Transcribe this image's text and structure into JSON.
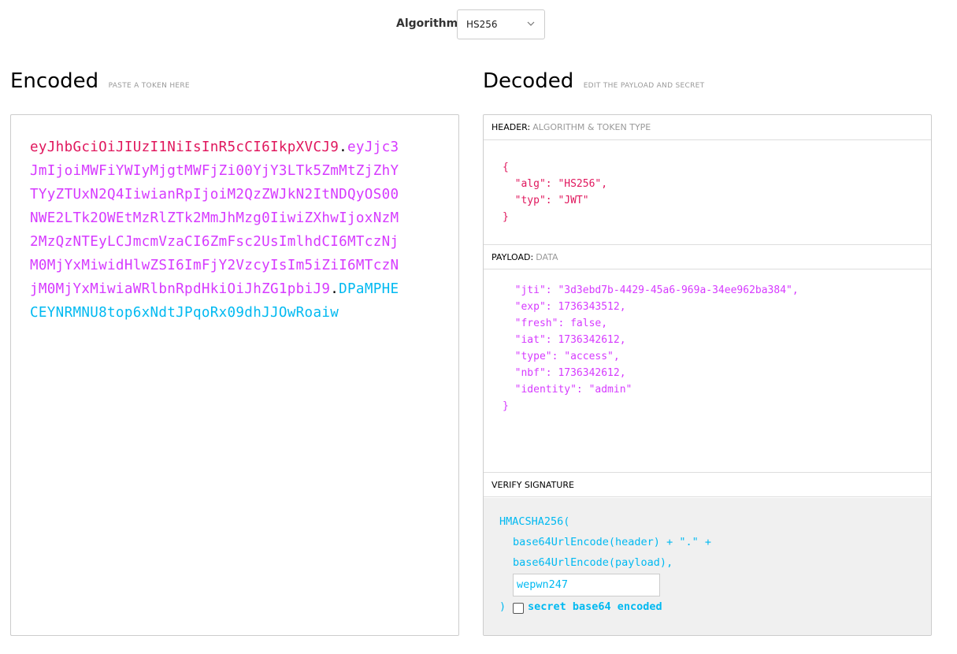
{
  "algorithm": {
    "label": "Algorithm",
    "selected": "HS256"
  },
  "encoded": {
    "title": "Encoded",
    "subtitle": "PASTE A TOKEN HERE",
    "token": {
      "header": "eyJhbGciOiJIUzI1NiIsInR5cCI6IkpXVCJ9",
      "payload": "eyJjc3JmIjoiMWFiYWIyMjgtMWFjZi00YjY3LTk5ZmMtZjZhYTYyZTUxN2Q4IiwianRpIjoiM2QzZWJkN2ItNDQyOS00NWE2LTk2OWEtMzRlZTk2MmJhMzg0IiwiZXhwIjoxNzM2MzQzNTEyLCJmcmVzaCI6ZmFsc2UsImlhdCI6MTczNjM0MjYxMiwidHlwZSI6ImFjY2VzcyIsIm5iZiI6MTczNjM0MjYxMiwiaWRlbnRpdHkiOiJhZG1pbiJ9",
      "signature": "DPaMPHECEYNRMNU8top6xNdtJPqoRx09dhJJOwRoaiw",
      "dot": "."
    }
  },
  "decoded": {
    "title": "Decoded",
    "subtitle": "EDIT THE PAYLOAD AND SECRET",
    "header_section": {
      "label": "HEADER:",
      "sub": "ALGORITHM & TOKEN TYPE"
    },
    "header_json": "{\n  \"alg\": \"HS256\",\n  \"typ\": \"JWT\"\n}",
    "payload_section": {
      "label": "PAYLOAD:",
      "sub": "DATA"
    },
    "payload_json": "  \"jti\": \"3d3ebd7b-4429-45a6-969a-34ee962ba384\",\n  \"exp\": 1736343512,\n  \"fresh\": false,\n  \"iat\": 1736342612,\n  \"type\": \"access\",\n  \"nbf\": 1736342612,\n  \"identity\": \"admin\"\n}",
    "verify_section": {
      "label": "VERIFY SIGNATURE"
    },
    "verify": {
      "line1": "HMACSHA256(",
      "line2": "base64UrlEncode(header) + \".\" +",
      "line3": "base64UrlEncode(payload),",
      "secret": "wepwn247",
      "close": ")",
      "checkbox_label": "secret base64 encoded"
    }
  },
  "colors": {
    "header": "#e0175d",
    "payload": "#d63aff",
    "signature": "#00b9f1"
  }
}
